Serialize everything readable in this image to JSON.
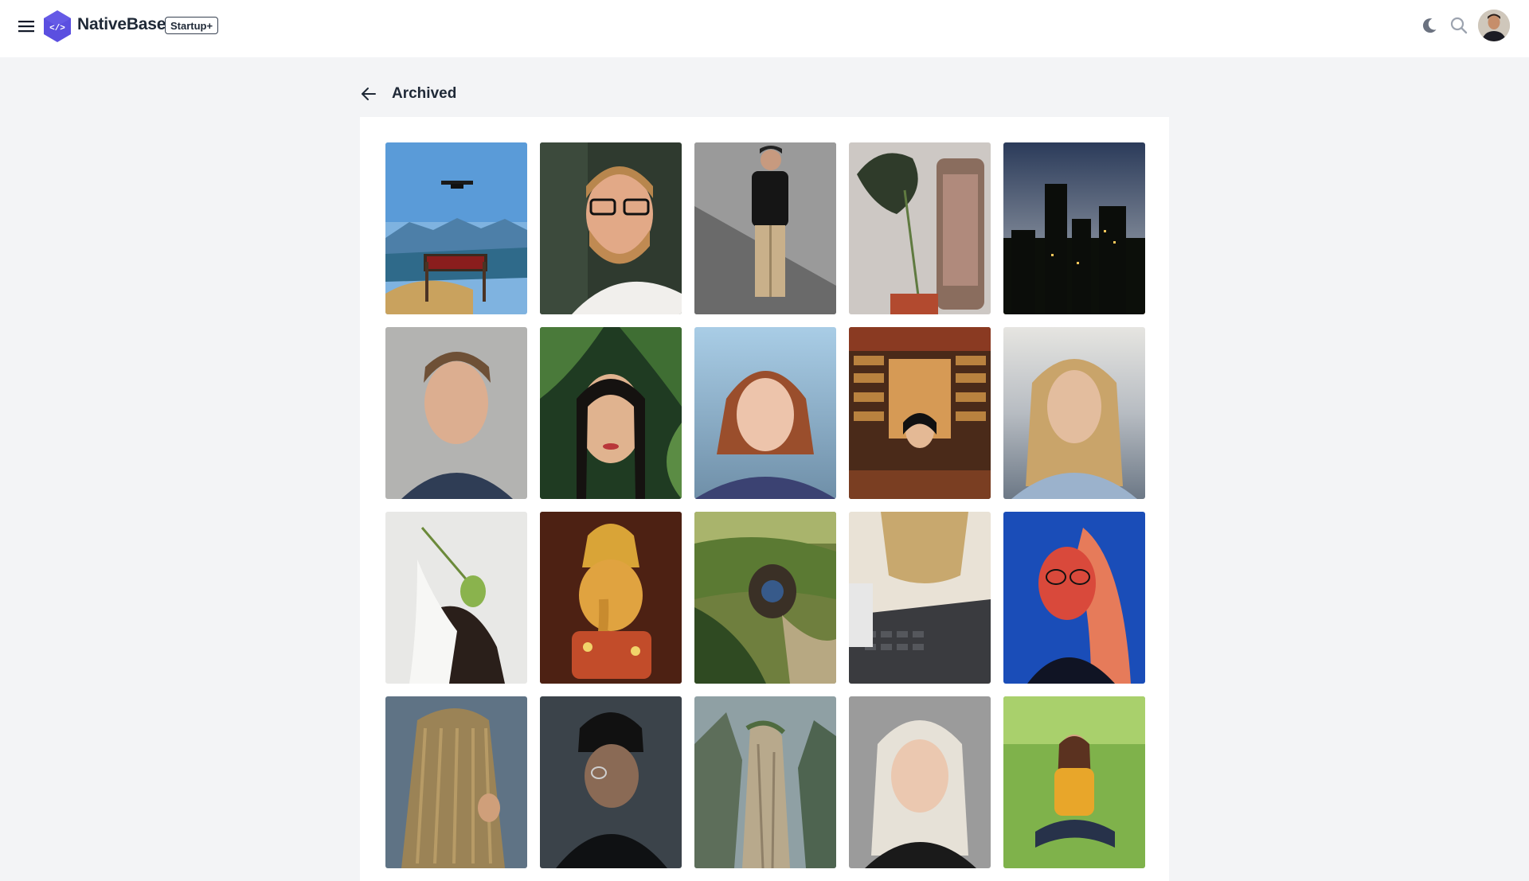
{
  "header": {
    "brand_name": "NativeBase",
    "plan_badge": "Startup+",
    "icons": [
      "menu-icon",
      "logo-icon",
      "moon-icon",
      "search-icon",
      "avatar"
    ]
  },
  "page": {
    "title": "Archived",
    "back_icon": "arrow-left-icon"
  },
  "colors": {
    "page_bg": "#f3f4f6",
    "surface": "#ffffff",
    "brand": "#5b4fe0",
    "text": "#1f2937"
  },
  "gallery": {
    "photos": [
      {
        "subject": "drone over sign and mountains"
      },
      {
        "subject": "bearded man with glasses"
      },
      {
        "subject": "man in black t-shirt"
      },
      {
        "subject": "monstera leaf and phone"
      },
      {
        "subject": "city skyline at dusk"
      },
      {
        "subject": "young man portrait"
      },
      {
        "subject": "woman among leaves"
      },
      {
        "subject": "red-haired woman"
      },
      {
        "subject": "woman reading in bookstore"
      },
      {
        "subject": "blonde woman by sea"
      },
      {
        "subject": "woman holding leaf"
      },
      {
        "subject": "ganesha statue"
      },
      {
        "subject": "hobbit house"
      },
      {
        "subject": "coffee cup and laptop"
      },
      {
        "subject": "woman with neon light"
      },
      {
        "subject": "person with dreadlocks"
      },
      {
        "subject": "man in black beanie"
      },
      {
        "subject": "stone pillar mountains"
      },
      {
        "subject": "platinum blonde woman"
      },
      {
        "subject": "woman sitting on grass"
      }
    ]
  }
}
